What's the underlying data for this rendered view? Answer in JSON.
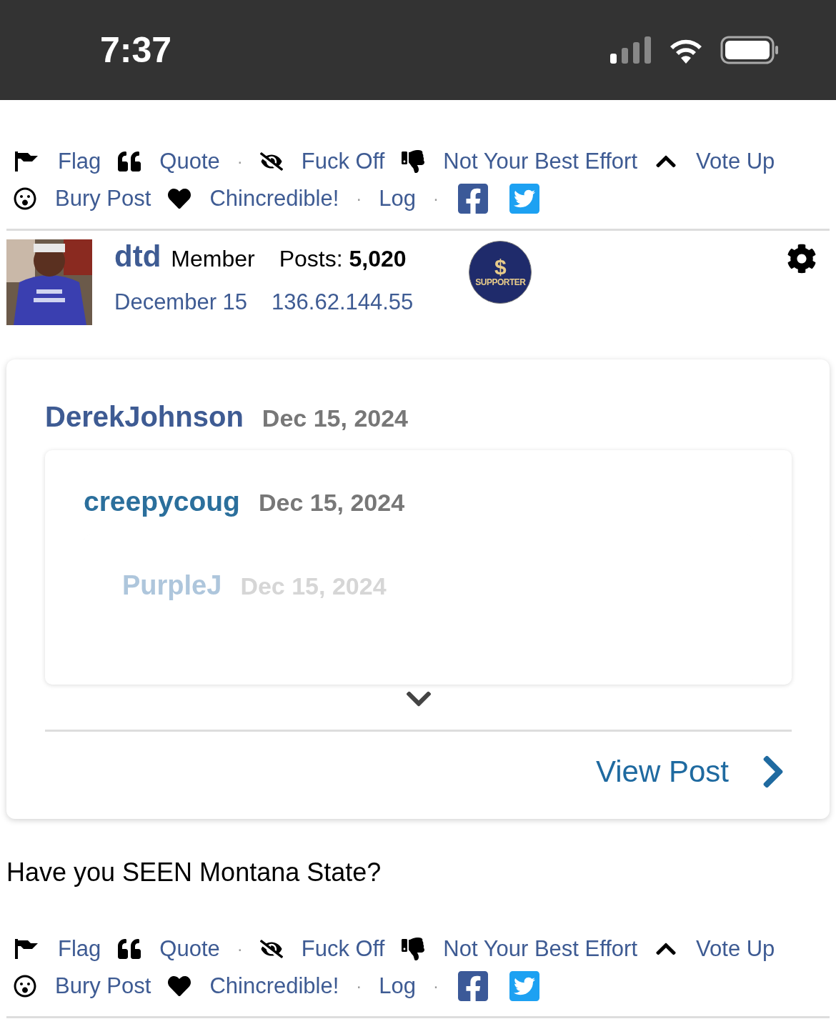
{
  "status_bar": {
    "time": "7:37"
  },
  "action_bars": [
    {
      "items": [
        {
          "kind": "flag",
          "label": "Flag"
        },
        {
          "kind": "quote",
          "label": "Quote"
        },
        {
          "kind": "dot",
          "label": "·"
        },
        {
          "kind": "hide",
          "label": "Fuck Off"
        },
        {
          "kind": "down",
          "label": "Not Your Best Effort"
        },
        {
          "kind": "up",
          "label": "Vote Up"
        },
        {
          "kind": "bury",
          "label": "Bury Post"
        },
        {
          "kind": "heart",
          "label": "Chincredible!"
        },
        {
          "kind": "dot",
          "label": "·"
        },
        {
          "kind": "log",
          "label": "Log"
        },
        {
          "kind": "dot",
          "label": "·"
        },
        {
          "kind": "facebook"
        },
        {
          "kind": "twitter"
        }
      ]
    },
    {
      "items": [
        {
          "kind": "flag",
          "label": "Flag"
        },
        {
          "kind": "quote",
          "label": "Quote"
        },
        {
          "kind": "dot",
          "label": "·"
        },
        {
          "kind": "hide",
          "label": "Fuck Off"
        },
        {
          "kind": "down",
          "label": "Not Your Best Effort"
        },
        {
          "kind": "up",
          "label": "Vote Up"
        },
        {
          "kind": "bury",
          "label": "Bury Post"
        },
        {
          "kind": "heart",
          "label": "Chincredible!"
        },
        {
          "kind": "dot",
          "label": "·"
        },
        {
          "kind": "log",
          "label": "Log"
        },
        {
          "kind": "dot",
          "label": "·"
        },
        {
          "kind": "facebook"
        },
        {
          "kind": "twitter"
        }
      ]
    }
  ],
  "post": {
    "author": "dtd",
    "role": "Member",
    "posts_label": "Posts:",
    "posts": "5,020",
    "badge": {
      "symbol": "$",
      "text": "SUPPORTER"
    },
    "date": "December 15",
    "ip": "136.62.144.55",
    "quote": {
      "author": "DerekJohnson",
      "date": "Dec 15, 2024",
      "view_post": "View Post",
      "nested": {
        "author": "creepycoug",
        "date": "Dec 15, 2024",
        "collapsed": true,
        "nested": {
          "author": "PurpleJ",
          "date": "Dec 15, 2024"
        }
      }
    },
    "body": "Have you SEEN Montana State?"
  }
}
